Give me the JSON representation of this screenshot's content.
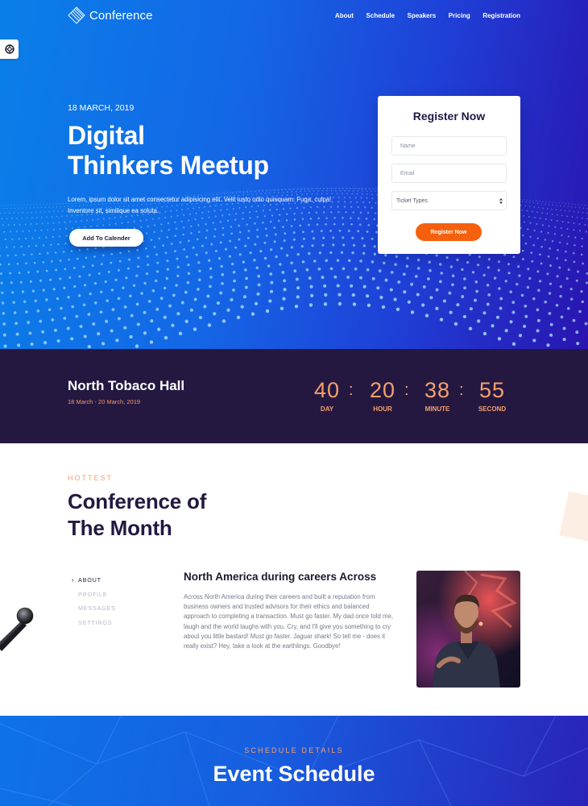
{
  "nav": {
    "logo_text": "Conference",
    "links": [
      "About",
      "Schedule",
      "Speakers",
      "Pricing",
      "Registration"
    ]
  },
  "hero": {
    "date": "18 MARCH, 2019",
    "title_line1": "Digital",
    "title_line2": "Thinkers Meetup",
    "description": "Lorem, ipsum dolor sit amet consectetur adipisicing elit. Velit iusto odio quisquam. Fuga, culpa! Inventore sit, similique ea soluta.",
    "cta_label": "Add To Calender"
  },
  "register": {
    "title": "Register Now",
    "name_placeholder": "Name",
    "email_placeholder": "Email",
    "ticket_select_value": "Ticket Types",
    "submit_label": "Register Now"
  },
  "venue": {
    "name": "North Tobaco Hall",
    "dates": "18 March - 20 March, 2019"
  },
  "countdown": {
    "days": "40",
    "hours": "20",
    "minutes": "38",
    "seconds": "55",
    "separator": ":",
    "labels": {
      "days": "DAY",
      "hours": "HOUR",
      "minutes": "MINUTE",
      "seconds": "SECOND"
    }
  },
  "hottest": {
    "eyebrow": "HOTTEST",
    "title_line1": "Conference of",
    "title_line2": "The Month",
    "tabs": [
      "ABOUT",
      "PROFILE",
      "MESSAGES",
      "SETTINGS"
    ],
    "active_tab": "ABOUT",
    "article_title": "North America during careers Across",
    "article_body": "Across North America during their careers and built a reputation from business owners and trusted advisors for their ethics and balanced approach to completing a transaction. Must go faster. My dad once told me, laugh and the world laughs with you, Cry, and I'll give you something to cry about you little bastard! Must go faster. Jaguar shark! So tell me - does it really exist? Hey, take a look at the earthlings. Goodbye!"
  },
  "schedule": {
    "eyebrow": "SCHEDULE DETAILS",
    "title": "Event Schedule"
  },
  "colors": {
    "accent": "#f5600f",
    "accent_soft": "#f5a06e",
    "dark": "#241841",
    "hero_blue": "#1466e6"
  },
  "icons": {
    "logo": "diamond-lines-icon",
    "side_tab": "lifebuoy-icon",
    "tab_chevron": "chevron-right-icon",
    "select": "select-arrows-icon"
  }
}
